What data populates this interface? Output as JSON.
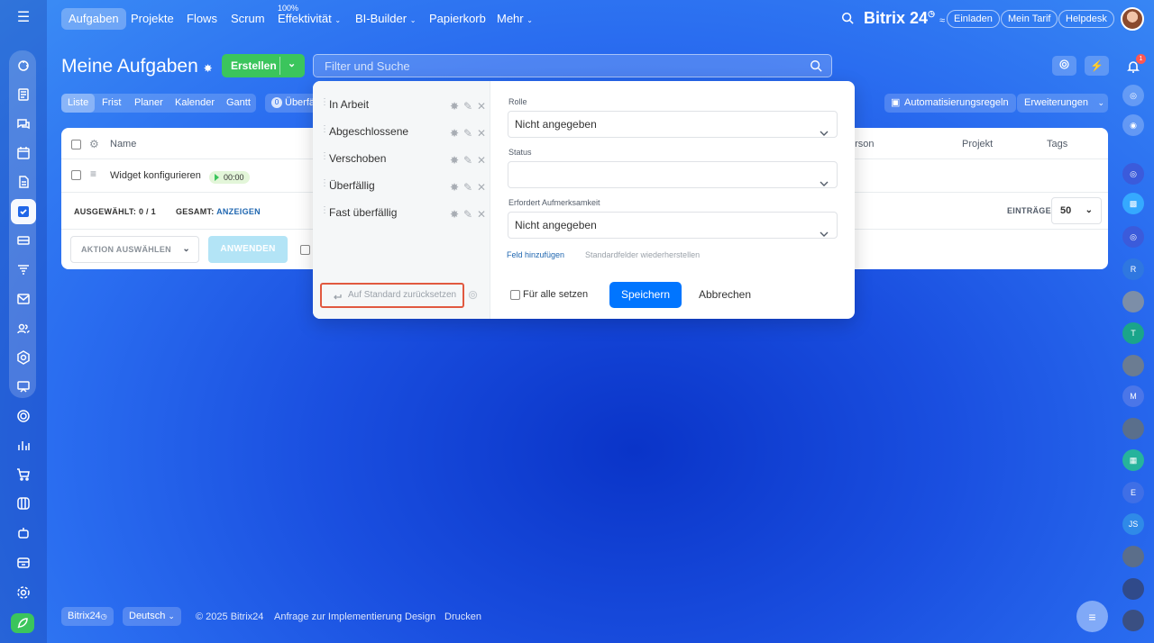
{
  "topnav": {
    "items": [
      "Aufgaben",
      "Projekte",
      "Flows",
      "Scrum",
      "Effektivität",
      "BI-Builder",
      "Papierkorb",
      "Mehr"
    ],
    "effektivitaet_badge": "100%",
    "brand": "Bitrix",
    "brand_num": "24",
    "invite": "Einladen",
    "my_plan": "Mein Tarif",
    "helpdesk": "Helpdesk"
  },
  "header": {
    "title": "Meine Aufgaben",
    "create_label": "Erstellen",
    "search_placeholder": "Filter und Suche"
  },
  "view_tabs": [
    "Liste",
    "Frist",
    "Planer",
    "Kalender",
    "Gantt"
  ],
  "counter": {
    "count": "0",
    "label": "Überfällig"
  },
  "toolbar": {
    "automation": "Automatisierungsregeln",
    "extensions": "Erweiterungen"
  },
  "table": {
    "col_name": "Name",
    "col_person": "erson",
    "col_project": "Projekt",
    "col_tags": "Tags",
    "row_title": "Widget konfigurieren",
    "row_timer": "00:00",
    "selected_label": "AUSGEWÄHLT:",
    "selected_value": "0 / 1",
    "total_label": "GESAMT:",
    "total_link": "ANZEIGEN",
    "entries_label": "EINTRÄGE",
    "entries_value": "50",
    "action_label": "AKTION AUSWÄHLEN",
    "apply_label": "ANWENDEN"
  },
  "filter_popup": {
    "presets": [
      "In Arbeit",
      "Abgeschlossene",
      "Verschoben",
      "Überfällig",
      "Fast überfällig"
    ],
    "reset_label": "Auf Standard zurücksetzen",
    "fields": [
      {
        "label": "Rolle",
        "value": "Nicht angegeben"
      },
      {
        "label": "Status",
        "value": ""
      },
      {
        "label": "Erfordert Aufmerksamkeit",
        "value": "Nicht angegeben"
      }
    ],
    "add_field": "Feld hinzufügen",
    "restore_fields": "Standardfelder wiederherstellen",
    "for_all": "Für alle setzen",
    "save": "Speichern",
    "cancel": "Abbrechen"
  },
  "right_bar": {
    "notification_count": "1",
    "avatars": [
      "R",
      "T",
      "M",
      "E",
      "JS"
    ]
  },
  "footer": {
    "brand": "Bitrix24",
    "language": "Deutsch",
    "copyright": "© 2025 Bitrix24",
    "link_impl": "Anfrage zur Implementierung",
    "link_design": "Design",
    "link_print": "Drucken"
  },
  "colors": {
    "accent": "#0075ff",
    "create_green": "#3bc55c",
    "highlight_red": "#e15940",
    "link_blue": "#2067b0"
  }
}
